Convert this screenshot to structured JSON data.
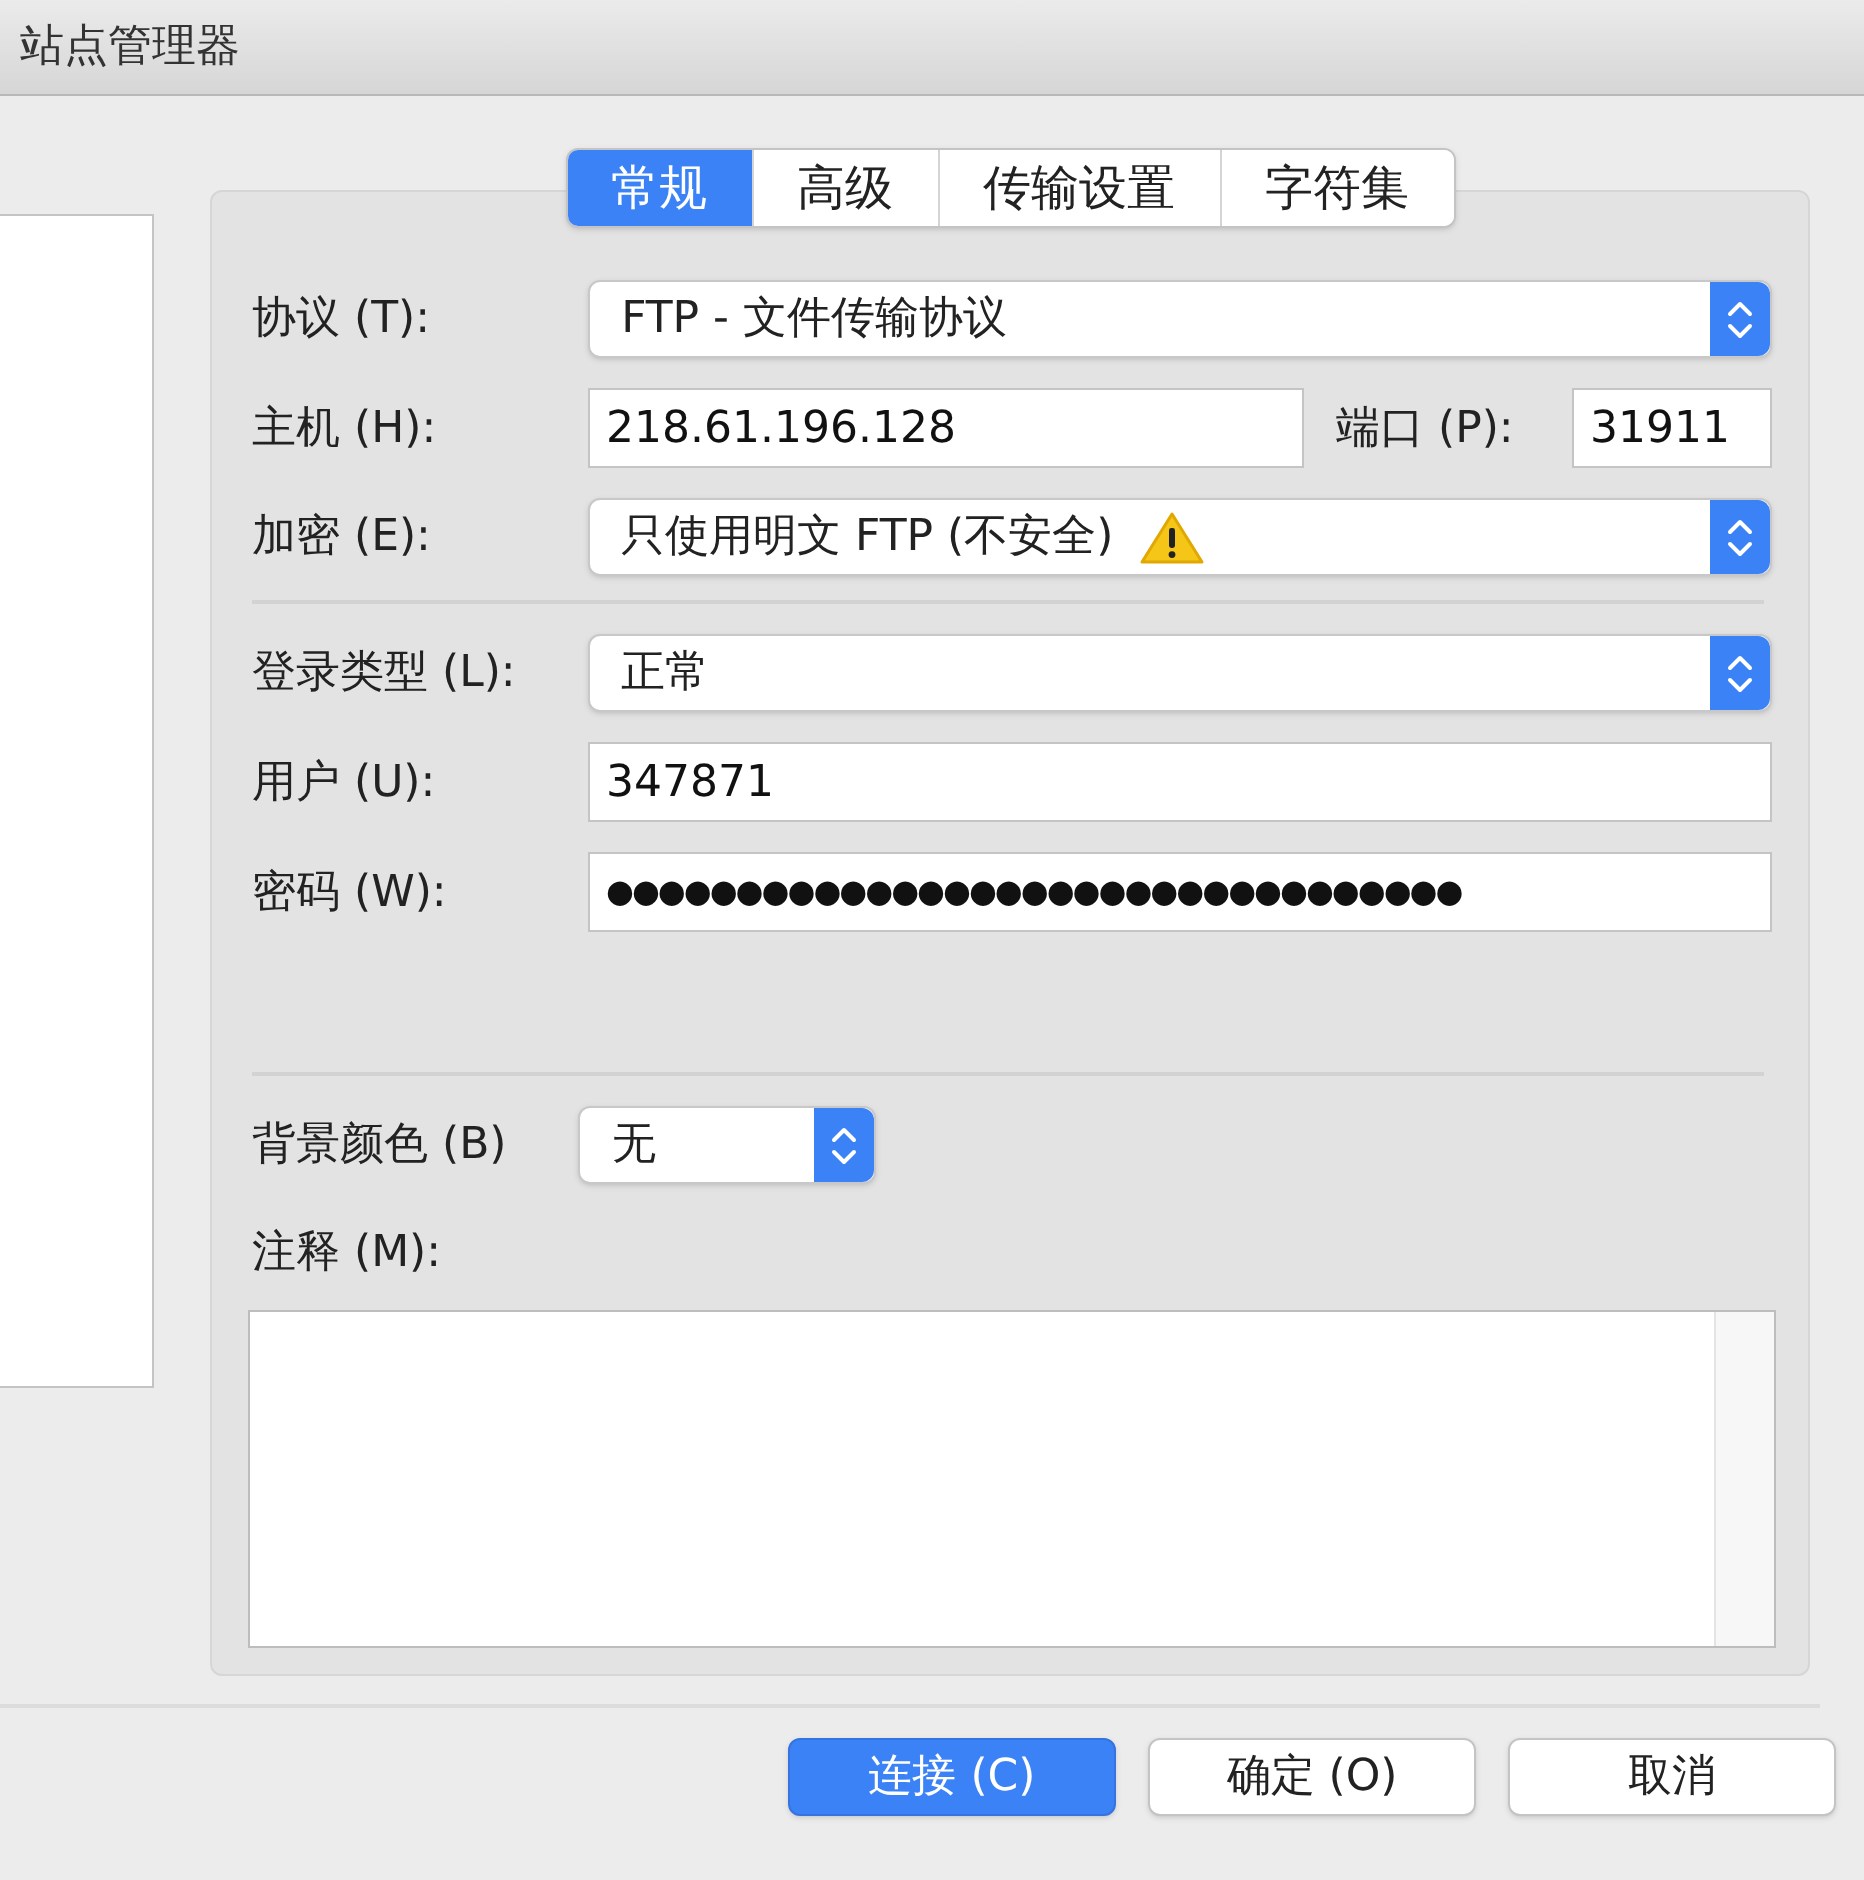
{
  "window": {
    "title": "站点管理器"
  },
  "tabs": [
    {
      "label": "常规",
      "selected": true
    },
    {
      "label": "高级",
      "selected": false
    },
    {
      "label": "传输设置",
      "selected": false
    },
    {
      "label": "字符集",
      "selected": false
    }
  ],
  "server_fields": [
    {
      "kind": "select",
      "label": "协议 (T):",
      "value": "FTP - 文件传输协议",
      "warning": false
    },
    {
      "kind": "host",
      "label": "主机 (H):",
      "value": "218.61.196.128",
      "port_label": "端口 (P):",
      "port_value": "31911"
    },
    {
      "kind": "select",
      "label": "加密 (E):",
      "value": "只使用明文 FTP (不安全)",
      "warning": true
    }
  ],
  "login_fields": [
    {
      "kind": "select",
      "label": "登录类型 (L):",
      "value": "正常",
      "warning": false
    },
    {
      "kind": "text",
      "label": "用户 (U):",
      "value": "347871"
    },
    {
      "kind": "password",
      "label": "密码 (W):",
      "value": "●●●●●●●●●●●●●●●●●●●●●●●●●●●●●●●●●"
    }
  ],
  "background_color": {
    "label": "背景颜色 (B)",
    "value": "无"
  },
  "comments": {
    "label": "注释 (M):"
  },
  "buttons": [
    {
      "label": "连接 (C)",
      "default": true
    },
    {
      "label": "确定 (O)",
      "default": false
    },
    {
      "label": "取消",
      "default": false
    }
  ]
}
